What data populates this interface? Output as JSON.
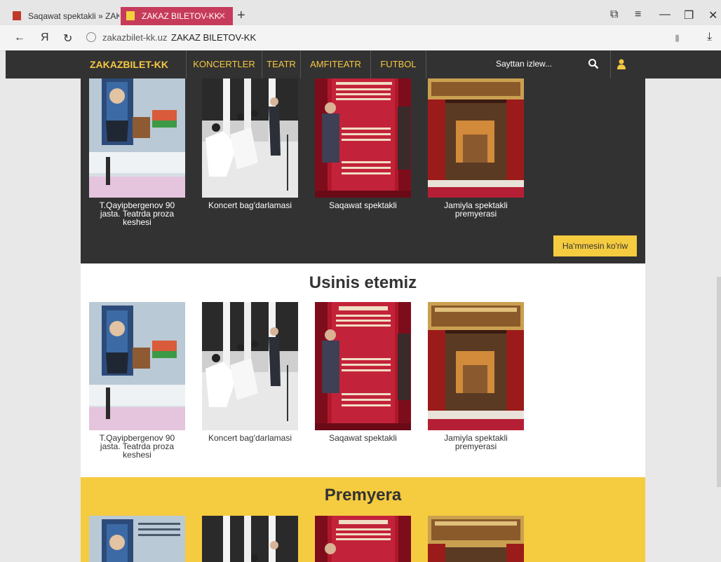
{
  "browser": {
    "tabs": [
      {
        "label": "Saqawat spektakli » ZAKAZ"
      },
      {
        "label": "ZAKAZ BILETOV-KK",
        "active": true
      }
    ],
    "new_tab": "+",
    "back": "←",
    "yandex": "Я",
    "reload": "↻",
    "url": "zakazbilet-kk.uz",
    "page_title": "ZAKAZ BILETOV-KK",
    "window_controls": {
      "minimize": "—",
      "restore": "❐",
      "close": "✕",
      "menu": "≡",
      "bookmark_panel": "⧉"
    }
  },
  "site": {
    "logo": "ZAKAZBILET-KK",
    "nav": [
      "KONCERTLER",
      "TEATR",
      "AMFITEATR",
      "FUTBOL"
    ],
    "search_placeholder": "Sayttan izlew...",
    "icons": {
      "search": "search-icon",
      "user": "user-icon"
    },
    "accent": "#f5cb40",
    "dark": "#323232"
  },
  "events": [
    {
      "caption": "T.Qayipbergenov 90 jasta. Teatrda proza keshesi"
    },
    {
      "caption": "Koncert bag'darlamasi"
    },
    {
      "caption": "Saqawat spektakli"
    },
    {
      "caption": "Jamiyla spektakli premyerasi"
    }
  ],
  "sections": {
    "top": {
      "all_button": "Ha'mmesin ko'riw"
    },
    "recommend": {
      "title": "Usinis etemiz"
    },
    "premiere": {
      "title": "Premyera"
    }
  }
}
